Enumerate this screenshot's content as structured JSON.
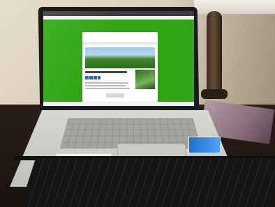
{
  "photo": {
    "subject": "laptop"
  },
  "colors": {
    "screen_green": "#30a614",
    "laptop_silver": "#c9cbc5",
    "desk_dark": "#1b1310",
    "wall_beige": "#ddd2bf"
  }
}
